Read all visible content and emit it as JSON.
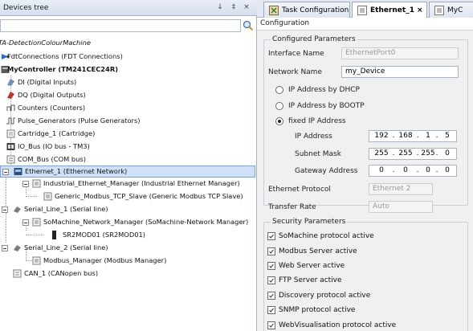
{
  "devices_tree": {
    "title": "Devices tree",
    "pin_glyph": "↓",
    "pin2_glyph": "‡",
    "close_glyph": "×",
    "search_value": "",
    "nodes": [
      {
        "label": "TA-DetectionColourMachine"
      },
      {
        "label": "FdtConnections (FDT Connections)"
      },
      {
        "label": "MyController (TM241CEC24R)"
      },
      {
        "label": "DI (Digital Inputs)"
      },
      {
        "label": "DQ (Digital Outputs)"
      },
      {
        "label": "Counters (Counters)"
      },
      {
        "label": "Pulse_Generators (Pulse Generators)"
      },
      {
        "label": "Cartridge_1 (Cartridge)"
      },
      {
        "label": "IO_Bus (IO bus - TM3)"
      },
      {
        "label": "COM_Bus (COM bus)"
      },
      {
        "label": "Ethernet_1 (Ethernet Network)"
      },
      {
        "label": "Industrial_Ethernet_Manager (Industrial Ethernet Manager)"
      },
      {
        "label": "Generic_Modbus_TCP_Slave (Generic Modbus TCP Slave)"
      },
      {
        "label": "Serial_Line_1 (Serial line)"
      },
      {
        "label": "SoMachine_Network_Manager (SoMachine-Network Manager)"
      },
      {
        "label": "SR2MOD01 (SR2MOD01)"
      },
      {
        "label": "Serial_Line_2 (Serial line)"
      },
      {
        "label": "Modbus_Manager (Modbus Manager)"
      },
      {
        "label": "CAN_1 (CANopen bus)"
      }
    ]
  },
  "editor": {
    "tabs": [
      {
        "label": "Task Configuration",
        "icon": "task-config-icon"
      },
      {
        "label": "Ethernet_1",
        "icon": "device-icon",
        "close": "×"
      },
      {
        "label": "MyC",
        "icon": "device-icon"
      }
    ],
    "sub_tab": "Configuration",
    "configured": {
      "title": "Configured Parameters",
      "interface_name_label": "Interface Name",
      "interface_name_value": "EthernetPort0",
      "network_name_label": "Network Name",
      "network_name_value": "my_Device",
      "dhcp_label": "IP Address by DHCP",
      "bootp_label": "IP Address by BOOTP",
      "fixed_label": "fixed IP Address",
      "ip_label": "IP Address",
      "ip": [
        "192",
        "168",
        "1",
        "5"
      ],
      "mask_label": "Subnet Mask",
      "mask": [
        "255",
        "255",
        "255",
        "0"
      ],
      "gateway_label": "Gateway Address",
      "gateway": [
        "0",
        "0",
        "0",
        "0"
      ],
      "protocol_label": "Ethernet Protocol",
      "protocol_value": "Ethernet 2",
      "rate_label": "Transfer Rate",
      "rate_value": "Auto"
    },
    "security": {
      "title": "Security Parameters",
      "items": [
        {
          "label": "SoMachine protocol active"
        },
        {
          "label": "Modbus Server active"
        },
        {
          "label": "Web Server active"
        },
        {
          "label": "FTP Server active"
        },
        {
          "label": "Discovery protocol active"
        },
        {
          "label": "SNMP protocol active"
        },
        {
          "label": "WebVisualisation protocol active"
        }
      ]
    }
  },
  "colors": {
    "selection": "#cfe1f7",
    "header": "#d4deeb",
    "accent": "#2a5aa8"
  }
}
